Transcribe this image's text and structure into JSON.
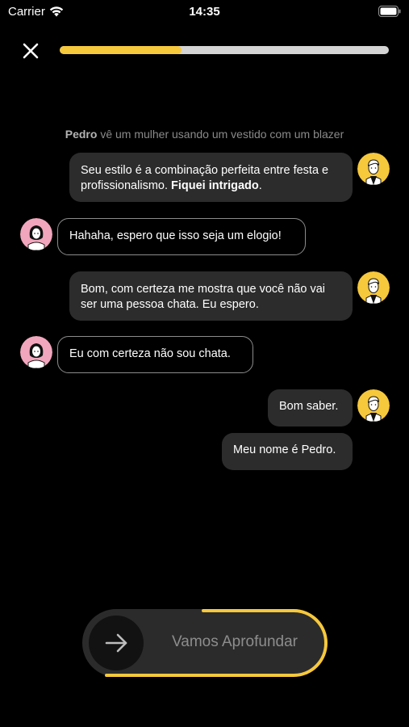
{
  "status_bar": {
    "carrier": "Carrier",
    "time": "14:35"
  },
  "progress": {
    "value_percent": 37,
    "fill_color": "#f6c83c",
    "track_color": "#d4d4d4"
  },
  "narration": {
    "name": "Pedro",
    "text": " vê um mulher usando um vestido com um blazer"
  },
  "messages": [
    {
      "from": "him",
      "text": "Seu estilo é a combinação perfeita entre festa e profissionalismo. ",
      "bold": "Fiquei intrigado",
      "tail": "."
    },
    {
      "from": "her",
      "text": "Hahaha, espero que isso seja um elogio!"
    },
    {
      "from": "him",
      "text": "Bom, com certeza me mostra que você não vai ser uma pessoa chata. Eu espero."
    },
    {
      "from": "her",
      "text": "Eu com certeza não sou chata."
    },
    {
      "from": "him",
      "text": "Bom saber."
    },
    {
      "from": "him",
      "text": "Meu nome é Pedro."
    }
  ],
  "action": {
    "label": "Vamos Aprofundar",
    "icon": "arrow-right-icon"
  },
  "colors": {
    "accent": "#f6c83c",
    "her_avatar_bg": "#f2a6bd",
    "him_avatar_bg": "#f6c83c"
  }
}
